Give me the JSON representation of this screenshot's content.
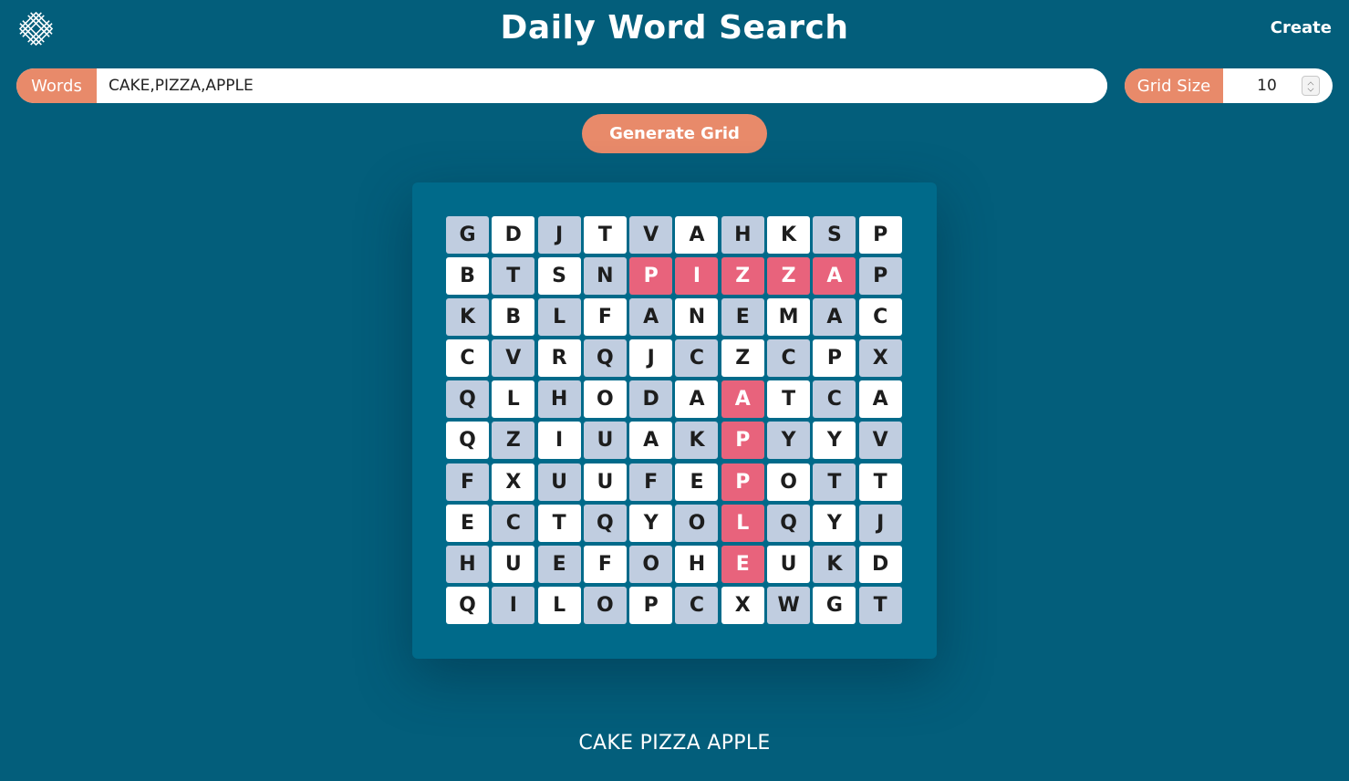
{
  "header": {
    "title": "Daily Word Search",
    "create_label": "Create",
    "logo_icon": "woven-knot-logo-icon"
  },
  "controls": {
    "words_label": "Words",
    "words_value": "CAKE,PIZZA,APPLE",
    "grid_size_label": "Grid Size",
    "grid_size_value": "10",
    "generate_label": "Generate Grid"
  },
  "grid": {
    "rows": [
      [
        "G",
        "D",
        "J",
        "T",
        "V",
        "A",
        "H",
        "K",
        "S",
        "P"
      ],
      [
        "B",
        "T",
        "S",
        "N",
        "P",
        "I",
        "Z",
        "Z",
        "A",
        "P"
      ],
      [
        "K",
        "B",
        "L",
        "F",
        "A",
        "N",
        "E",
        "M",
        "A",
        "C"
      ],
      [
        "C",
        "V",
        "R",
        "Q",
        "J",
        "C",
        "Z",
        "C",
        "P",
        "X"
      ],
      [
        "Q",
        "L",
        "H",
        "O",
        "D",
        "A",
        "A",
        "T",
        "C",
        "A"
      ],
      [
        "Q",
        "Z",
        "I",
        "U",
        "A",
        "K",
        "P",
        "Y",
        "Y",
        "V"
      ],
      [
        "F",
        "X",
        "U",
        "U",
        "F",
        "E",
        "P",
        "O",
        "T",
        "T"
      ],
      [
        "E",
        "C",
        "T",
        "Q",
        "Y",
        "O",
        "L",
        "Q",
        "Y",
        "J"
      ],
      [
        "H",
        "U",
        "E",
        "F",
        "O",
        "H",
        "E",
        "U",
        "K",
        "D"
      ],
      [
        "Q",
        "I",
        "L",
        "O",
        "P",
        "C",
        "X",
        "W",
        "G",
        "T"
      ]
    ],
    "highlighted": [
      [
        1,
        4
      ],
      [
        1,
        5
      ],
      [
        1,
        6
      ],
      [
        1,
        7
      ],
      [
        1,
        8
      ],
      [
        4,
        6
      ],
      [
        5,
        6
      ],
      [
        6,
        6
      ],
      [
        7,
        6
      ],
      [
        8,
        6
      ]
    ]
  },
  "word_list": "CAKE PIZZA APPLE",
  "colors": {
    "background": "#035e7b",
    "card": "#006a8a",
    "accent": "#e88a6a",
    "highlight": "#e8637c",
    "cell_light": "#ffffff",
    "cell_dark": "#c0cde0"
  }
}
